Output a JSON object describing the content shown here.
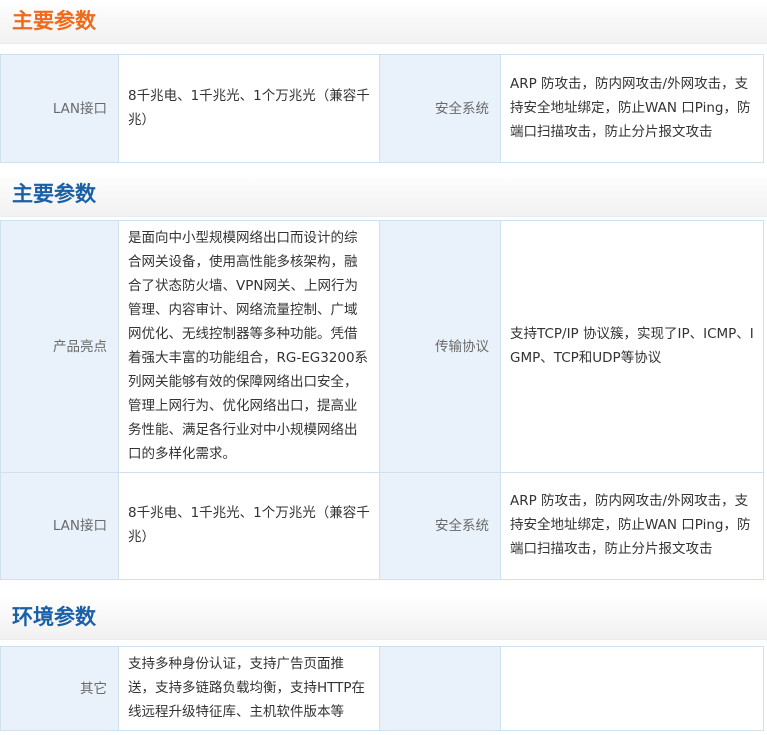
{
  "colors": {
    "title_orange": "#ee6b1c",
    "title_blue": "#1b5fa6",
    "label_bg": "#e9f2fa",
    "border": "#cfe0ef"
  },
  "sections": [
    {
      "title": "主要参数",
      "rows": [
        {
          "label_left": "LAN接口",
          "value_left": "8千兆电、1千兆光、1个万兆光（兼容千兆）",
          "label_right": "安全系统",
          "value_right": "ARP 防攻击，防内网攻击/外网攻击，支持安全地址绑定，防止WAN 口Ping，防端口扫描攻击，防止分片报文攻击"
        }
      ]
    },
    {
      "title": "主要参数",
      "rows": [
        {
          "label_left": "产品亮点",
          "value_left": "是面向中小型规模网络出口而设计的综合网关设备，使用高性能多核架构，融合了状态防火墙、VPN网关、上网行为管理、内容审计、网络流量控制、广域网优化、无线控制器等多种功能。凭借着强大丰富的功能组合，RG-EG3200系列网关能够有效的保障网络出口安全，管理上网行为、优化网络出口，提高业务性能、满足各行业对中小规模网络出口的多样化需求。",
          "label_right": "传输协议",
          "value_right": "支持TCP/IP 协议簇，实现了IP、ICMP、IGMP、TCP和UDP等协议"
        },
        {
          "label_left": "LAN接口",
          "value_left": "8千兆电、1千兆光、1个万兆光（兼容千兆）",
          "label_right": "安全系统",
          "value_right": "ARP 防攻击，防内网攻击/外网攻击，支持安全地址绑定，防止WAN 口Ping，防端口扫描攻击，防止分片报文攻击"
        }
      ]
    },
    {
      "title": "环境参数",
      "rows": [
        {
          "label_left": "其它",
          "value_left": "支持多种身份认证，支持广告页面推送，支持多链路负载均衡，支持HTTP在线远程升级特征库、主机软件版本等",
          "label_right": "",
          "value_right": ""
        }
      ]
    }
  ]
}
